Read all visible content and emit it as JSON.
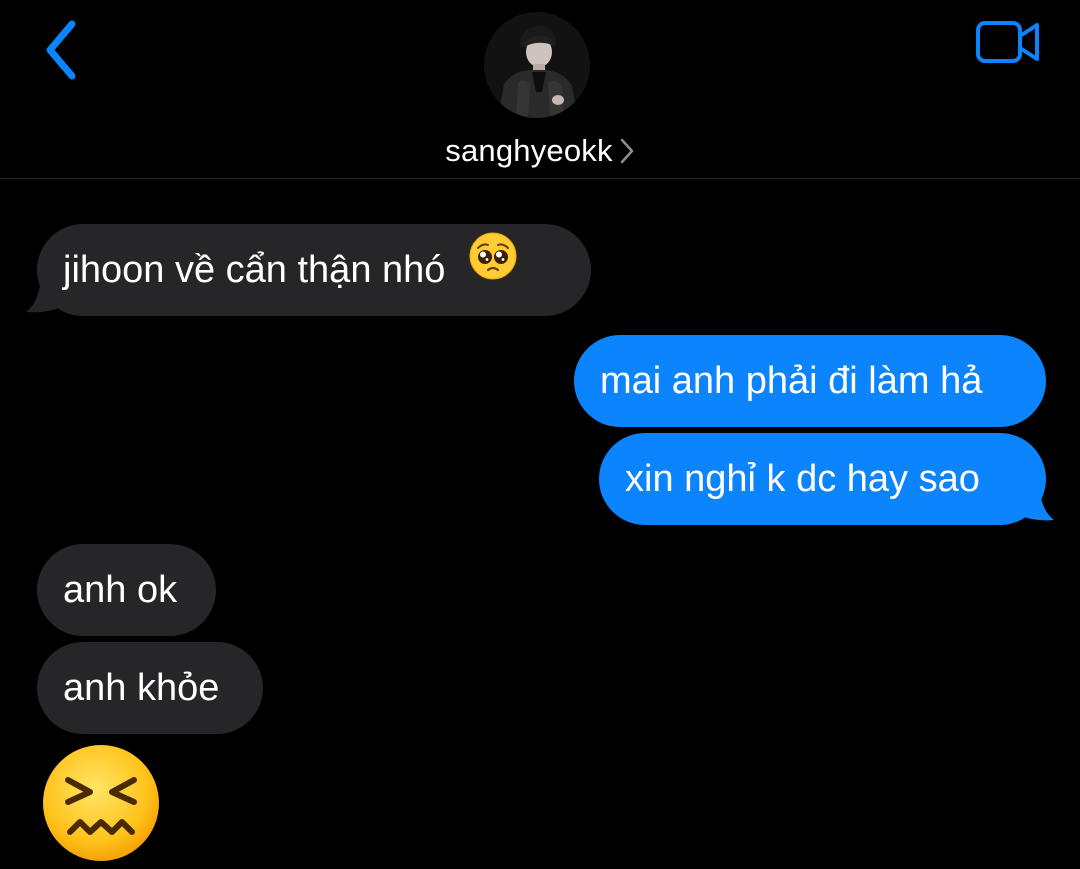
{
  "header": {
    "contact_name": "sanghyeokk",
    "back_icon": "chevron-left-icon",
    "video_icon": "video-camera-icon",
    "avatar_icon": "profile-photo",
    "accent_color": "#0b84fe"
  },
  "messages": [
    {
      "direction": "incoming",
      "text": "jihoon về cẩn thận nhó",
      "emoji": "pleading-face-emoji"
    },
    {
      "direction": "outgoing",
      "text": "mai anh phải đi làm hả"
    },
    {
      "direction": "outgoing",
      "text": "xin nghỉ k dc hay sao"
    },
    {
      "direction": "incoming",
      "text": "anh ok"
    },
    {
      "direction": "incoming",
      "text": "anh khỏe"
    },
    {
      "direction": "incoming",
      "emoji": "confounded-face-emoji"
    }
  ],
  "colors": {
    "background": "#000000",
    "incoming_bubble": "#262628",
    "outgoing_bubble": "#0b84fe"
  }
}
